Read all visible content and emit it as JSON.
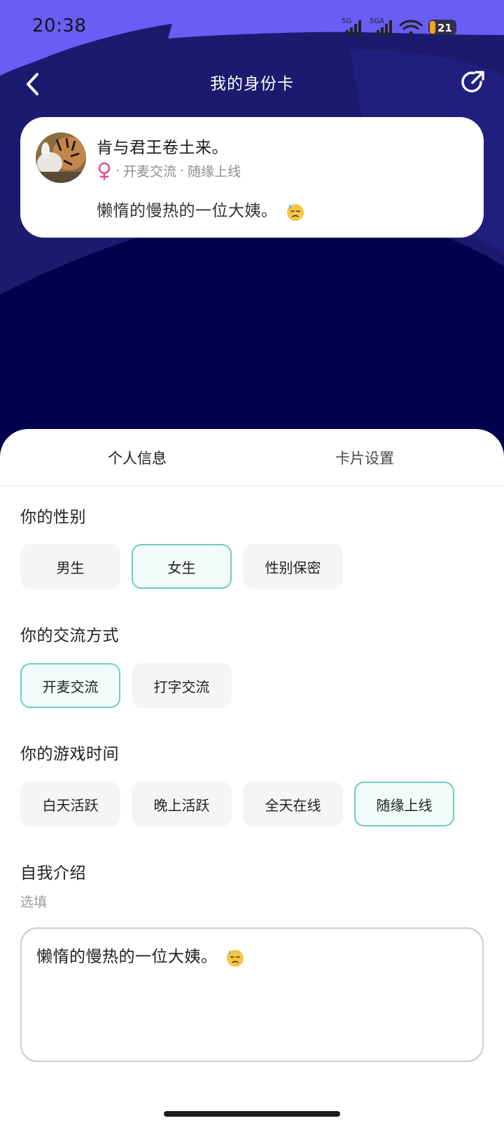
{
  "status_bar": {
    "time": "20:38",
    "signal1_label": "5G",
    "signal2_label": "5GA",
    "battery": "21"
  },
  "nav": {
    "title": "我的身份卡"
  },
  "card": {
    "name": "肯与君王卷土来。",
    "gender_icon": "female-icon",
    "comm_mode": "开麦交流",
    "online_time": "随缘上线",
    "separator": "·",
    "bio": "懒惰的慢热的一位大姨。"
  },
  "tabs": [
    {
      "label": "个人信息",
      "active": true
    },
    {
      "label": "卡片设置",
      "active": false
    }
  ],
  "gender_section": {
    "title": "你的性别",
    "options": [
      {
        "label": "男生",
        "selected": false
      },
      {
        "label": "女生",
        "selected": true
      },
      {
        "label": "性别保密",
        "selected": false
      }
    ]
  },
  "comm_section": {
    "title": "你的交流方式",
    "options": [
      {
        "label": "开麦交流",
        "selected": true
      },
      {
        "label": "打字交流",
        "selected": false
      }
    ]
  },
  "time_section": {
    "title": "你的游戏时间",
    "options": [
      {
        "label": "白天活跃",
        "selected": false
      },
      {
        "label": "晚上活跃",
        "selected": false
      },
      {
        "label": "全天在线",
        "selected": false
      },
      {
        "label": "随缘上线",
        "selected": true
      }
    ]
  },
  "intro_section": {
    "title": "自我介绍",
    "hint": "选填",
    "value": "懒惰的慢热的一位大姨。"
  },
  "colors": {
    "header_purple": "#6a5cf5",
    "header_navy": "#1b1a6e",
    "background_dark": "#02014d",
    "selected_border": "#6ecdc0",
    "female_pink": "#e0509a"
  }
}
